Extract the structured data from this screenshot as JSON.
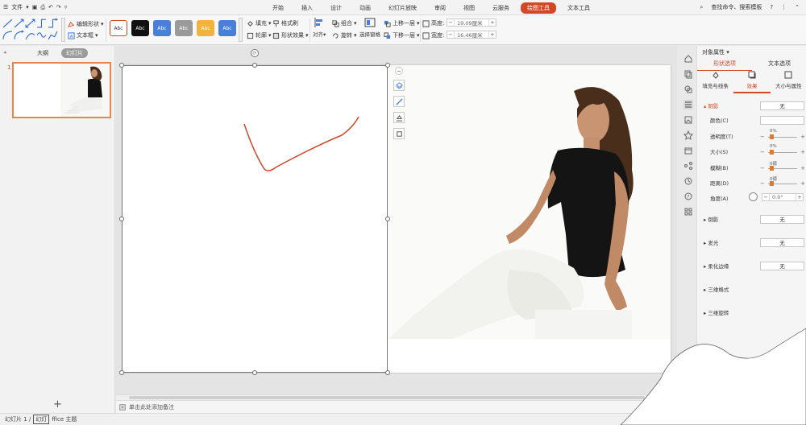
{
  "menubar": {
    "file_label": "文件",
    "tabs": [
      "开始",
      "插入",
      "设计",
      "动画",
      "幻灯片放映",
      "审阅",
      "视图",
      "云服务",
      "绘图工具",
      "文本工具"
    ],
    "active_tab_index": 8,
    "search_label": "查找命令、搜索模板",
    "help_label": "?"
  },
  "ribbon": {
    "edit_shape_label": "编辑形状",
    "textbox_label": "文本框",
    "style_boxes": [
      {
        "label": "Abc",
        "bg": "#ffffff",
        "fg": "#333333",
        "border": "#d24726"
      },
      {
        "label": "Abc",
        "bg": "#111111",
        "fg": "#ffffff",
        "border": "#111111"
      },
      {
        "label": "Abc",
        "bg": "#4a7fd8",
        "fg": "#ffffff",
        "border": "#4a7fd8"
      },
      {
        "label": "Abc",
        "bg": "#9a9a9a",
        "fg": "#ffffff",
        "border": "#9a9a9a"
      },
      {
        "label": "Abc",
        "bg": "#f0b43c",
        "fg": "#ffffff",
        "border": "#f0b43c"
      },
      {
        "label": "Abc",
        "bg": "#4a7fd8",
        "fg": "#ffffff",
        "border": "#4a7fd8"
      }
    ],
    "fill_label": "填充",
    "format_brush_label": "格式刷",
    "outline_label": "轮廓",
    "shape_effect_label": "形状效果",
    "align_label": "对齐",
    "group_label": "组合",
    "rotate_label": "旋转",
    "selection_pane_label": "选择窗格",
    "bring_forward_label": "上移一层",
    "send_backward_label": "下移一层",
    "height_label": "高度:",
    "height_value": "19.09厘米",
    "width_label": "宽度:",
    "width_value": "16.46厘米"
  },
  "leftpane": {
    "tab_outline": "大纲",
    "tab_slides": "幻灯片",
    "slide_number": "1",
    "add_label": "+"
  },
  "notes": {
    "placeholder": "单击此处添加备注"
  },
  "props": {
    "title": "对象属性",
    "tab_shape": "形状选项",
    "tab_text": "文本选项",
    "sub_fill": "填充与线条",
    "sub_effect": "效果",
    "sub_size": "大小与属性",
    "shadow_label": "阴影",
    "shadow_value": "无",
    "color_label": "颜色(C)",
    "transparency_label": "透明度(T)",
    "transparency_value": "0%",
    "size_label": "大小(S)",
    "size_value": "0%",
    "blur_label": "模糊(B)",
    "blur_value": "0磅",
    "distance_label": "距离(D)",
    "distance_value": "0磅",
    "angle_label": "角度(A)",
    "angle_value": "0.0°",
    "reflection_label": "倒影",
    "reflection_value": "无",
    "glow_label": "发光",
    "glow_value": "无",
    "soft_edge_label": "柔化边缘",
    "soft_edge_value": "无",
    "three_d_format_label": "三维格式",
    "three_d_rotation_label": "三维旋转"
  },
  "status": {
    "slide_info": "幻灯片 1 /",
    "theme_box": "幻灯",
    "theme_rest": "ffice 主题"
  },
  "colors": {
    "accent": "#d24726",
    "stroke_red": "#d2472b"
  }
}
